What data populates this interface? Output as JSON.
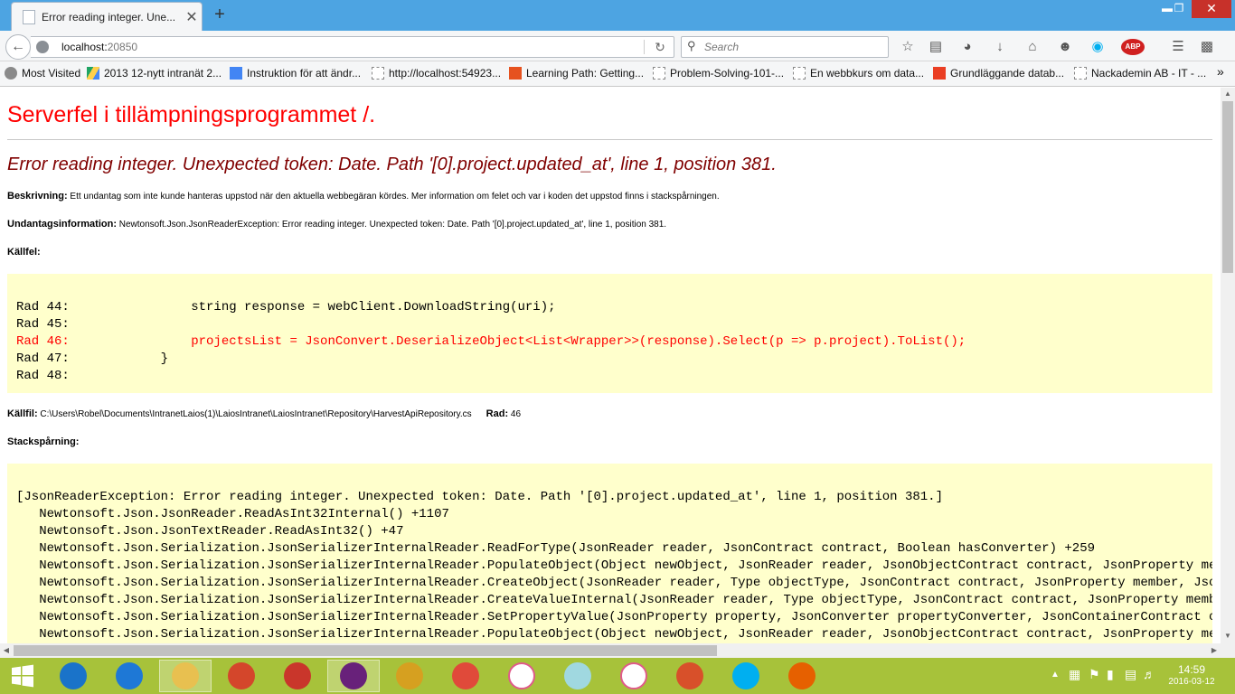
{
  "browser": {
    "tab_title": "Error reading integer. Une...",
    "tab_close": "✕",
    "new_tab": "+",
    "window_controls": {
      "minimize": "▬",
      "restore": "❐",
      "close": "✕"
    },
    "url_host": "localhost:",
    "url_port": "20850",
    "search_placeholder": "Search",
    "bookmarks": [
      {
        "label": "Most Visited",
        "icon": "gear-icon"
      },
      {
        "label": "2013 12-nytt intranät 2...",
        "icon": "drive-icon"
      },
      {
        "label": "Instruktion för att ändr...",
        "icon": "doc-icon"
      },
      {
        "label": "http://localhost:54923...",
        "icon": "blank-page-icon"
      },
      {
        "label": "Learning Path: Getting...",
        "icon": "play-icon"
      },
      {
        "label": "Problem-Solving-101-...",
        "icon": "blank-page-icon"
      },
      {
        "label": "En webbkurs om data...",
        "icon": "blank-page-icon"
      },
      {
        "label": "Grundläggande datab...",
        "icon": "office-icon"
      },
      {
        "label": "Nackademin AB - IT - ...",
        "icon": "blank-page-icon"
      }
    ],
    "bookmarks_overflow": "»"
  },
  "page": {
    "title": "Serverfel i tillämpningsprogrammet /.",
    "error_message": "Error reading integer. Unexpected token: Date. Path '[0].project.updated_at', line 1, position 381.",
    "description_label": "Beskrivning:",
    "description_text": " Ett undantag som inte kunde hanteras uppstod när den aktuella webbegäran kördes. Mer information om felet och var i koden det uppstod finns i stackspårningen.",
    "exception_label": "Undantagsinformation:",
    "exception_text": " Newtonsoft.Json.JsonReaderException: Error reading integer. Unexpected token: Date. Path '[0].project.updated_at', line 1, position 381.",
    "source_error_label": "Källfel:",
    "source_lines": [
      "Rad 44:                string response = webClient.DownloadString(uri);",
      "Rad 45:",
      "Rad 46:                projectsList = JsonConvert.DeserializeObject<List<Wrapper>>(response).Select(p => p.project).ToList();",
      "Rad 47:            }",
      "Rad 48:"
    ],
    "highlighted_line_index": 2,
    "source_file_label": "Källfil:",
    "source_file_path": " C:\\Users\\Robel\\Documents\\IntranetLaios(1)\\LaiosIntranet\\LaiosIntranet\\Repository\\HarvestApiRepository.cs",
    "line_label": "Rad:",
    "line_number": " 46",
    "stack_trace_label": "Stackspårning:",
    "stack_lines": [
      "[JsonReaderException: Error reading integer. Unexpected token: Date. Path '[0].project.updated_at', line 1, position 381.]",
      "   Newtonsoft.Json.JsonReader.ReadAsInt32Internal() +1107",
      "   Newtonsoft.Json.JsonTextReader.ReadAsInt32() +47",
      "   Newtonsoft.Json.Serialization.JsonSerializerInternalReader.ReadForType(JsonReader reader, JsonContract contract, Boolean hasConverter) +259",
      "   Newtonsoft.Json.Serialization.JsonSerializerInternalReader.PopulateObject(Object newObject, JsonReader reader, JsonObjectContract contract, JsonProperty member, Str",
      "   Newtonsoft.Json.Serialization.JsonSerializerInternalReader.CreateObject(JsonReader reader, Type objectType, JsonContract contract, JsonProperty member, JsonContaine",
      "   Newtonsoft.Json.Serialization.JsonSerializerInternalReader.CreateValueInternal(JsonReader reader, Type objectType, JsonContract contract, JsonProperty member, JsonC",
      "   Newtonsoft.Json.Serialization.JsonSerializerInternalReader.SetPropertyValue(JsonProperty property, JsonConverter propertyConverter, JsonContainerContract containerC",
      "   Newtonsoft.Json.Serialization.JsonSerializerInternalReader.PopulateObject(Object newObject, JsonReader reader, JsonObjectContract contract, JsonProperty member, Str"
    ]
  },
  "taskbar": {
    "apps": [
      {
        "name": "rdp-icon",
        "color": "#1a73c9"
      },
      {
        "name": "teamviewer-icon",
        "color": "#1e78d6"
      },
      {
        "name": "file-explorer-icon",
        "color": "#e8c050"
      },
      {
        "name": "headphones-icon",
        "color": "#d4462b"
      },
      {
        "name": "pdf-icon",
        "color": "#c9362b"
      },
      {
        "name": "visual-studio-icon",
        "color": "#68217a"
      },
      {
        "name": "tools-icon",
        "color": "#d6a020"
      },
      {
        "name": "chrome-icon",
        "color": "#e04a3a"
      },
      {
        "name": "apps-grid-icon",
        "color": "#ffffff"
      },
      {
        "name": "notes-icon",
        "color": "#a0d8e0"
      },
      {
        "name": "itunes-icon",
        "color": "#ffffff"
      },
      {
        "name": "filezilla-icon",
        "color": "#d8502a"
      },
      {
        "name": "skype-icon",
        "color": "#00aff0"
      },
      {
        "name": "firefox-icon",
        "color": "#e66000"
      }
    ],
    "time": "14:59",
    "date": "2016-03-12"
  },
  "colors": {
    "taskbar": "#a7c23a",
    "titlebar": "#4da4e2",
    "error_red": "#ff0000",
    "error_maroon": "#800000",
    "code_bg": "#ffffcc"
  }
}
